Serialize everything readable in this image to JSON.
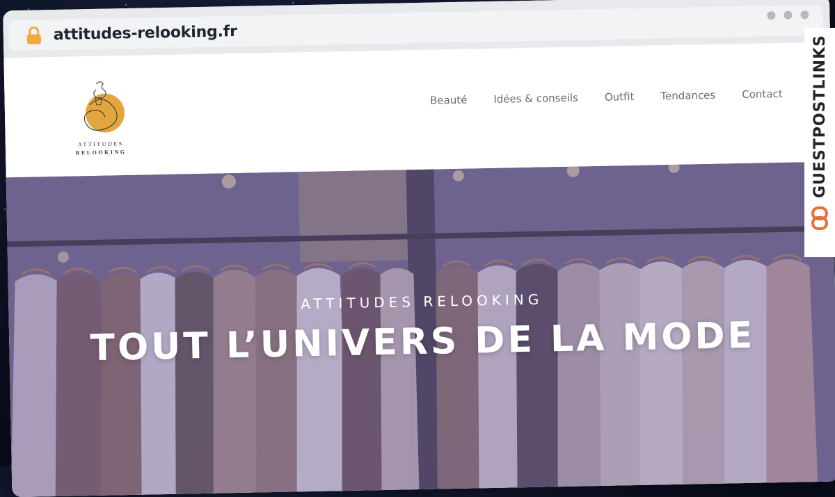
{
  "browser": {
    "url": "attitudes-relooking.fr",
    "icons": [
      "lock-icon",
      "window-dot-icon"
    ]
  },
  "site": {
    "logo": {
      "line1": "ATTITUDES",
      "line2": "RELOOKING",
      "accent_color": "#e3a63f"
    },
    "nav": [
      {
        "label": "Beauté"
      },
      {
        "label": "Idées & conseils"
      },
      {
        "label": "Outfit"
      },
      {
        "label": "Tendances"
      },
      {
        "label": "Contact"
      }
    ],
    "hero": {
      "kicker": "ATTITUDES RELOOKING",
      "title": "TOUT L’UNIVERS DE LA MODE",
      "overlay_color": "#6e5f96"
    }
  },
  "watermark": {
    "text": "GUESTPOSTLINKS",
    "icon": "link-icon",
    "icon_color": "#f06b3a"
  }
}
